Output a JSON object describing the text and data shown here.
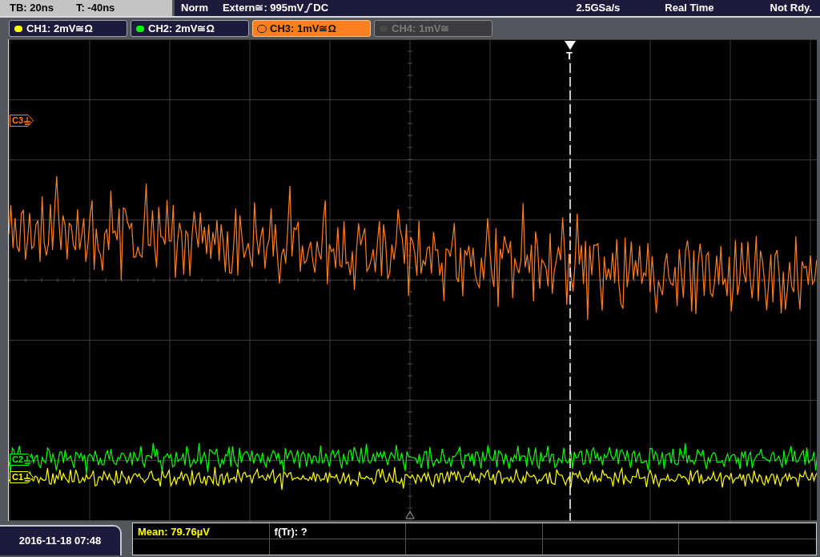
{
  "status_bar": {
    "timebase": "TB: 20ns",
    "trigger_time": "T: -40ns",
    "mode": "Norm",
    "trigger_source": "Extern≅: 995mV",
    "trigger_coupling": "DC",
    "sample_rate": "2.5GSa/s",
    "acquisition": "Real Time",
    "state": "Not Rdy."
  },
  "channels": [
    {
      "label": "CH1: 2mV≅Ω",
      "color": "#ffff00",
      "on": true,
      "selected": false
    },
    {
      "label": "CH2: 2mV≅Ω",
      "color": "#00ff00",
      "on": true,
      "selected": false
    },
    {
      "label": "CH3: 1mV≅Ω",
      "color": "#ff7f1e",
      "on": true,
      "selected": true
    },
    {
      "label": "CH4: 1mV≅",
      "color": "#4a4a4a",
      "on": false,
      "selected": false
    }
  ],
  "markers": [
    {
      "label": "C3",
      "color": "#ff7f1e"
    },
    {
      "label": "C2",
      "color": "#00ff00"
    },
    {
      "label": "C1",
      "color": "#ffff00"
    }
  ],
  "trigger_marker": "T",
  "measurements": [
    {
      "text": "Mean: 79.76µV",
      "color": "#ffff00"
    },
    {
      "text": "f(Tr): ?",
      "color": "#ffffff"
    }
  ],
  "date": "2016-11-18 07:48"
}
